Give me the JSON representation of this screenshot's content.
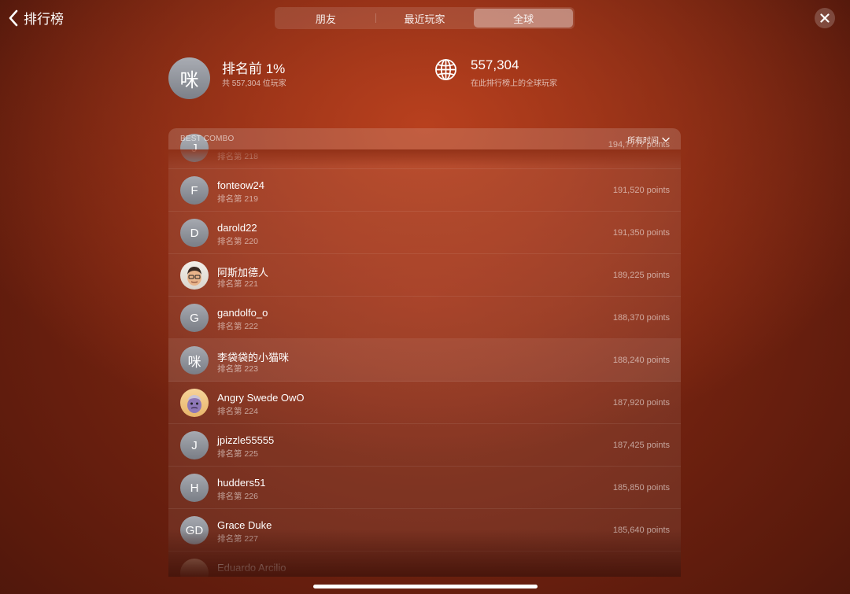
{
  "nav": {
    "back_label": "排行榜"
  },
  "tabs": [
    {
      "label": "朋友",
      "active": false
    },
    {
      "label": "最近玩家",
      "active": false
    },
    {
      "label": "全球",
      "active": true
    }
  ],
  "summary": {
    "avatar_text": "咪",
    "rank_title": "排名前 1%",
    "rank_sub": "共 557,304 位玩家",
    "global_count": "557,304",
    "global_sub": "在此排行榜上的全球玩家",
    "globe_icon": "globe-icon"
  },
  "board": {
    "title": "BEST COMBO",
    "time_filter": "所有时间",
    "rows": [
      {
        "initial": "J",
        "name": "",
        "rank": "排名第 218",
        "points": "194,???? points",
        "avatar_type": "initial"
      },
      {
        "initial": "F",
        "name": "fonteow24",
        "rank": "排名第 219",
        "points": "191,520 points",
        "avatar_type": "initial"
      },
      {
        "initial": "D",
        "name": "darold22",
        "rank": "排名第 220",
        "points": "191,350 points",
        "avatar_type": "initial"
      },
      {
        "initial": "",
        "name": "阿斯加德人",
        "rank": "排名第 221",
        "points": "189,225 points",
        "avatar_type": "memoji-man"
      },
      {
        "initial": "G",
        "name": "gandolfo_o",
        "rank": "排名第 222",
        "points": "188,370 points",
        "avatar_type": "initial"
      },
      {
        "initial": "咪",
        "name": "李袋袋的小猫咪",
        "rank": "排名第 223",
        "points": "188,240 points",
        "avatar_type": "initial",
        "is_me": true
      },
      {
        "initial": "",
        "name": "Angry Swede OwO",
        "rank": "排名第 224",
        "points": "187,920 points",
        "avatar_type": "memoji-purple"
      },
      {
        "initial": "J",
        "name": "jpizzle55555",
        "rank": "排名第 225",
        "points": "187,425 points",
        "avatar_type": "initial"
      },
      {
        "initial": "H",
        "name": "hudders51",
        "rank": "排名第 226",
        "points": "185,850 points",
        "avatar_type": "initial"
      },
      {
        "initial": "GD",
        "name": "Grace Duke",
        "rank": "排名第 227",
        "points": "185,640 points",
        "avatar_type": "initial"
      },
      {
        "initial": "",
        "name": "Eduardo Arcilio",
        "rank": "",
        "points": "",
        "avatar_type": "memoji-partial"
      }
    ]
  }
}
